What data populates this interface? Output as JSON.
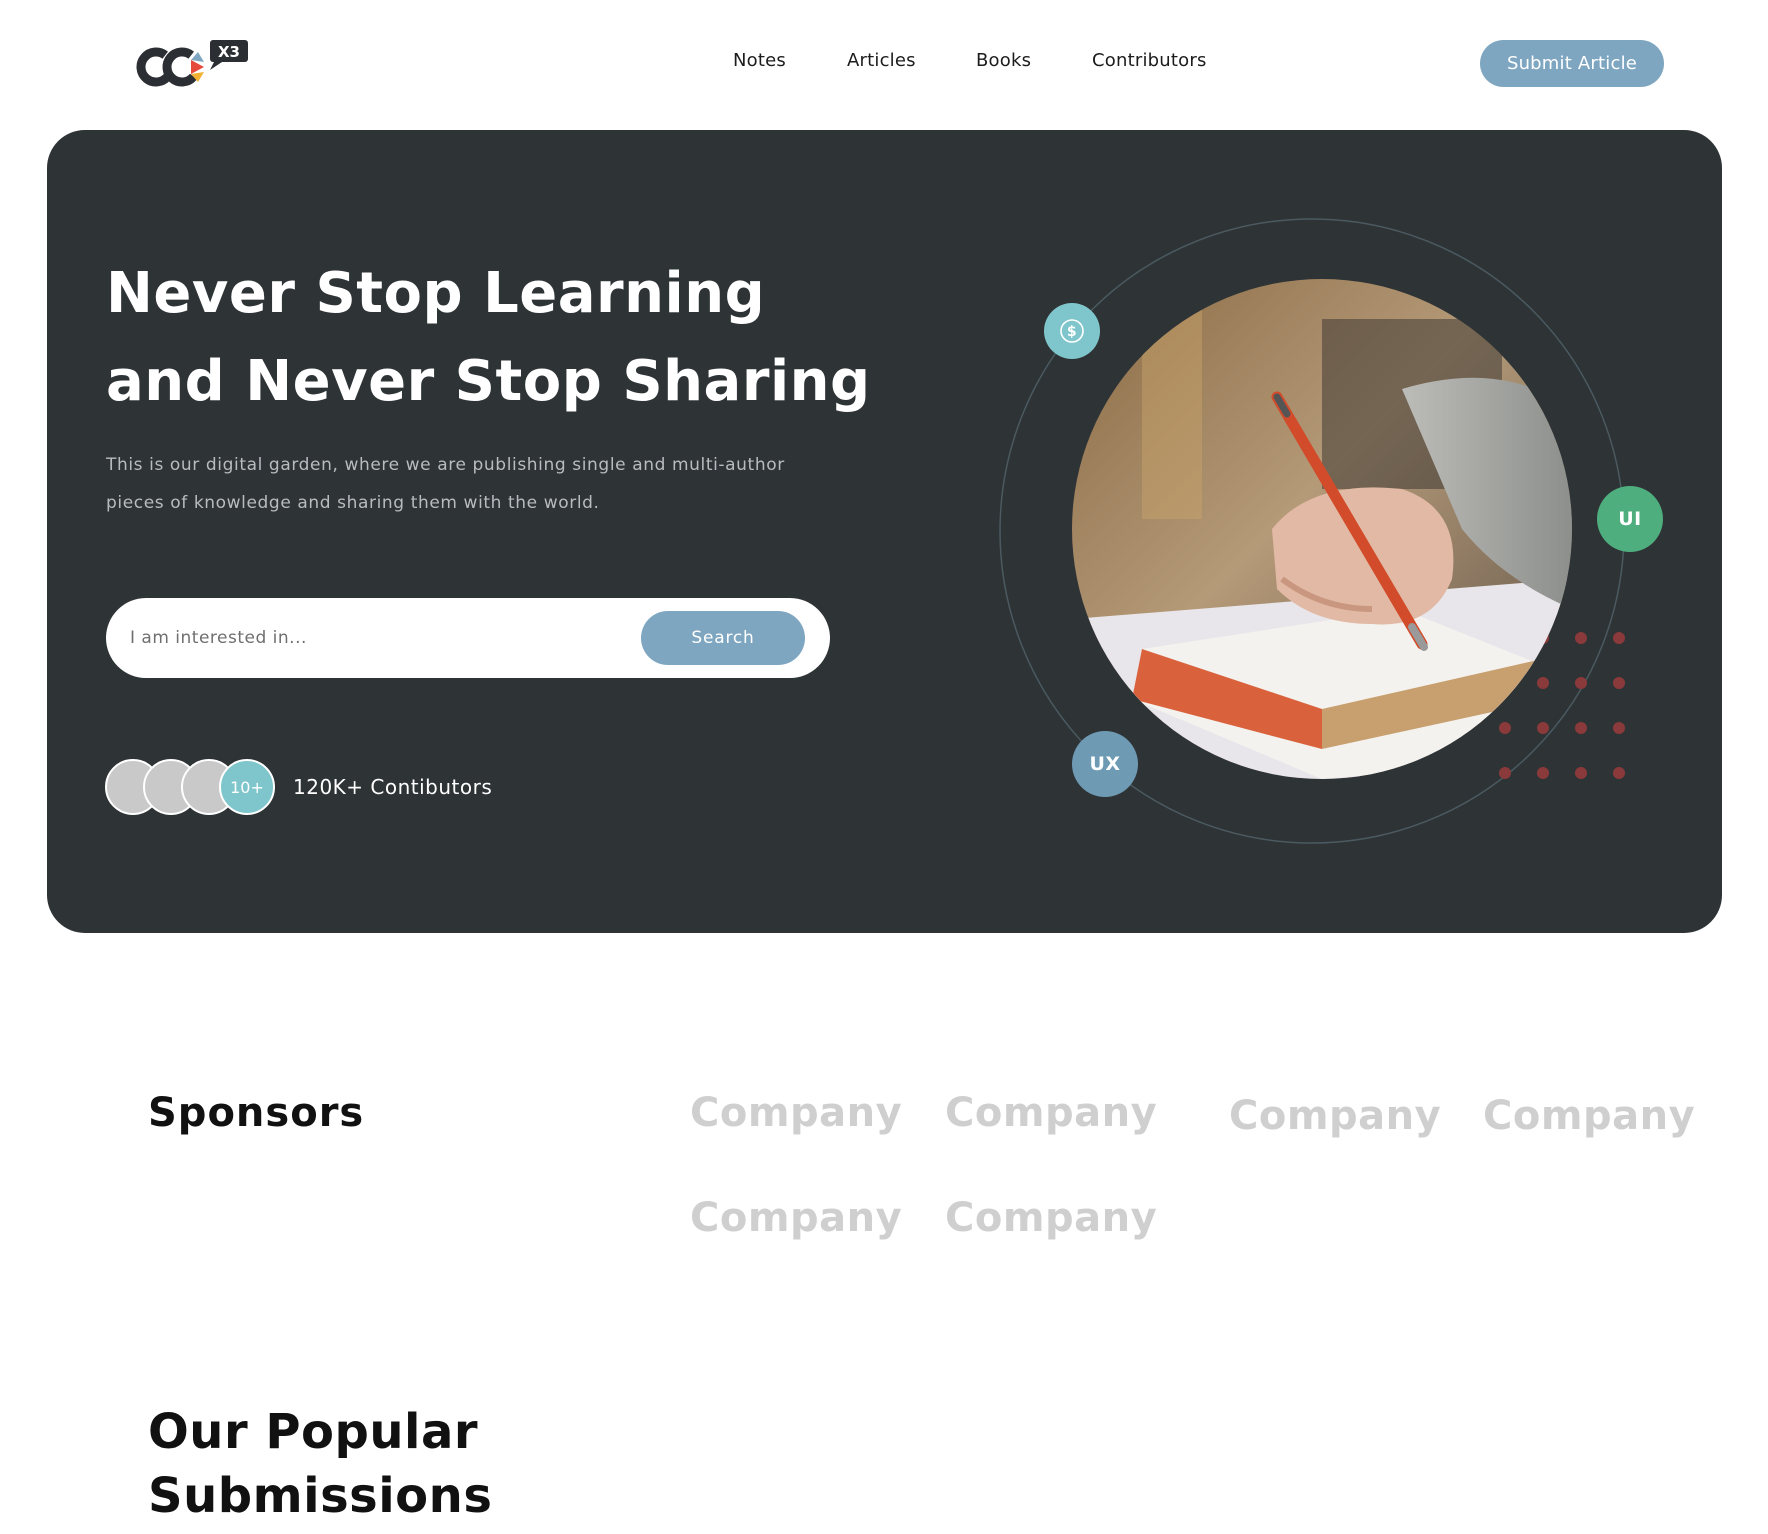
{
  "header": {
    "logo_text": "CC",
    "logo_badge": "X3",
    "nav": [
      "Notes",
      "Articles",
      "Books",
      "Contributors"
    ],
    "submit_label": "Submit Article"
  },
  "hero": {
    "title_line1": "Never Stop Learning",
    "title_line2": "and Never Stop Sharing",
    "desc_line1": "This is our digital garden, where we are publishing single and multi-author",
    "desc_line2": "pieces of knowledge and sharing them with the world.",
    "search_placeholder": "I am interested in...",
    "search_button": "Search",
    "avatars_more": "10+",
    "contributors_label": "120K+ Contibutors",
    "badges": {
      "dollar_icon": "dollar-icon",
      "ui": "UI",
      "ux": "UX"
    }
  },
  "sponsors": {
    "title": "Sponsors",
    "companies": [
      "Company",
      "Company",
      "Company",
      "Company",
      "Company",
      "Company"
    ]
  },
  "popular": {
    "title_line1": "Our Popular",
    "title_line2": "Submissions"
  },
  "colors": {
    "hero_bg": "#2e3336",
    "accent_blue": "#7ea6c1",
    "teal": "#7fc6cc",
    "green": "#4fae7e",
    "dot_red": "#8a3a3a"
  }
}
